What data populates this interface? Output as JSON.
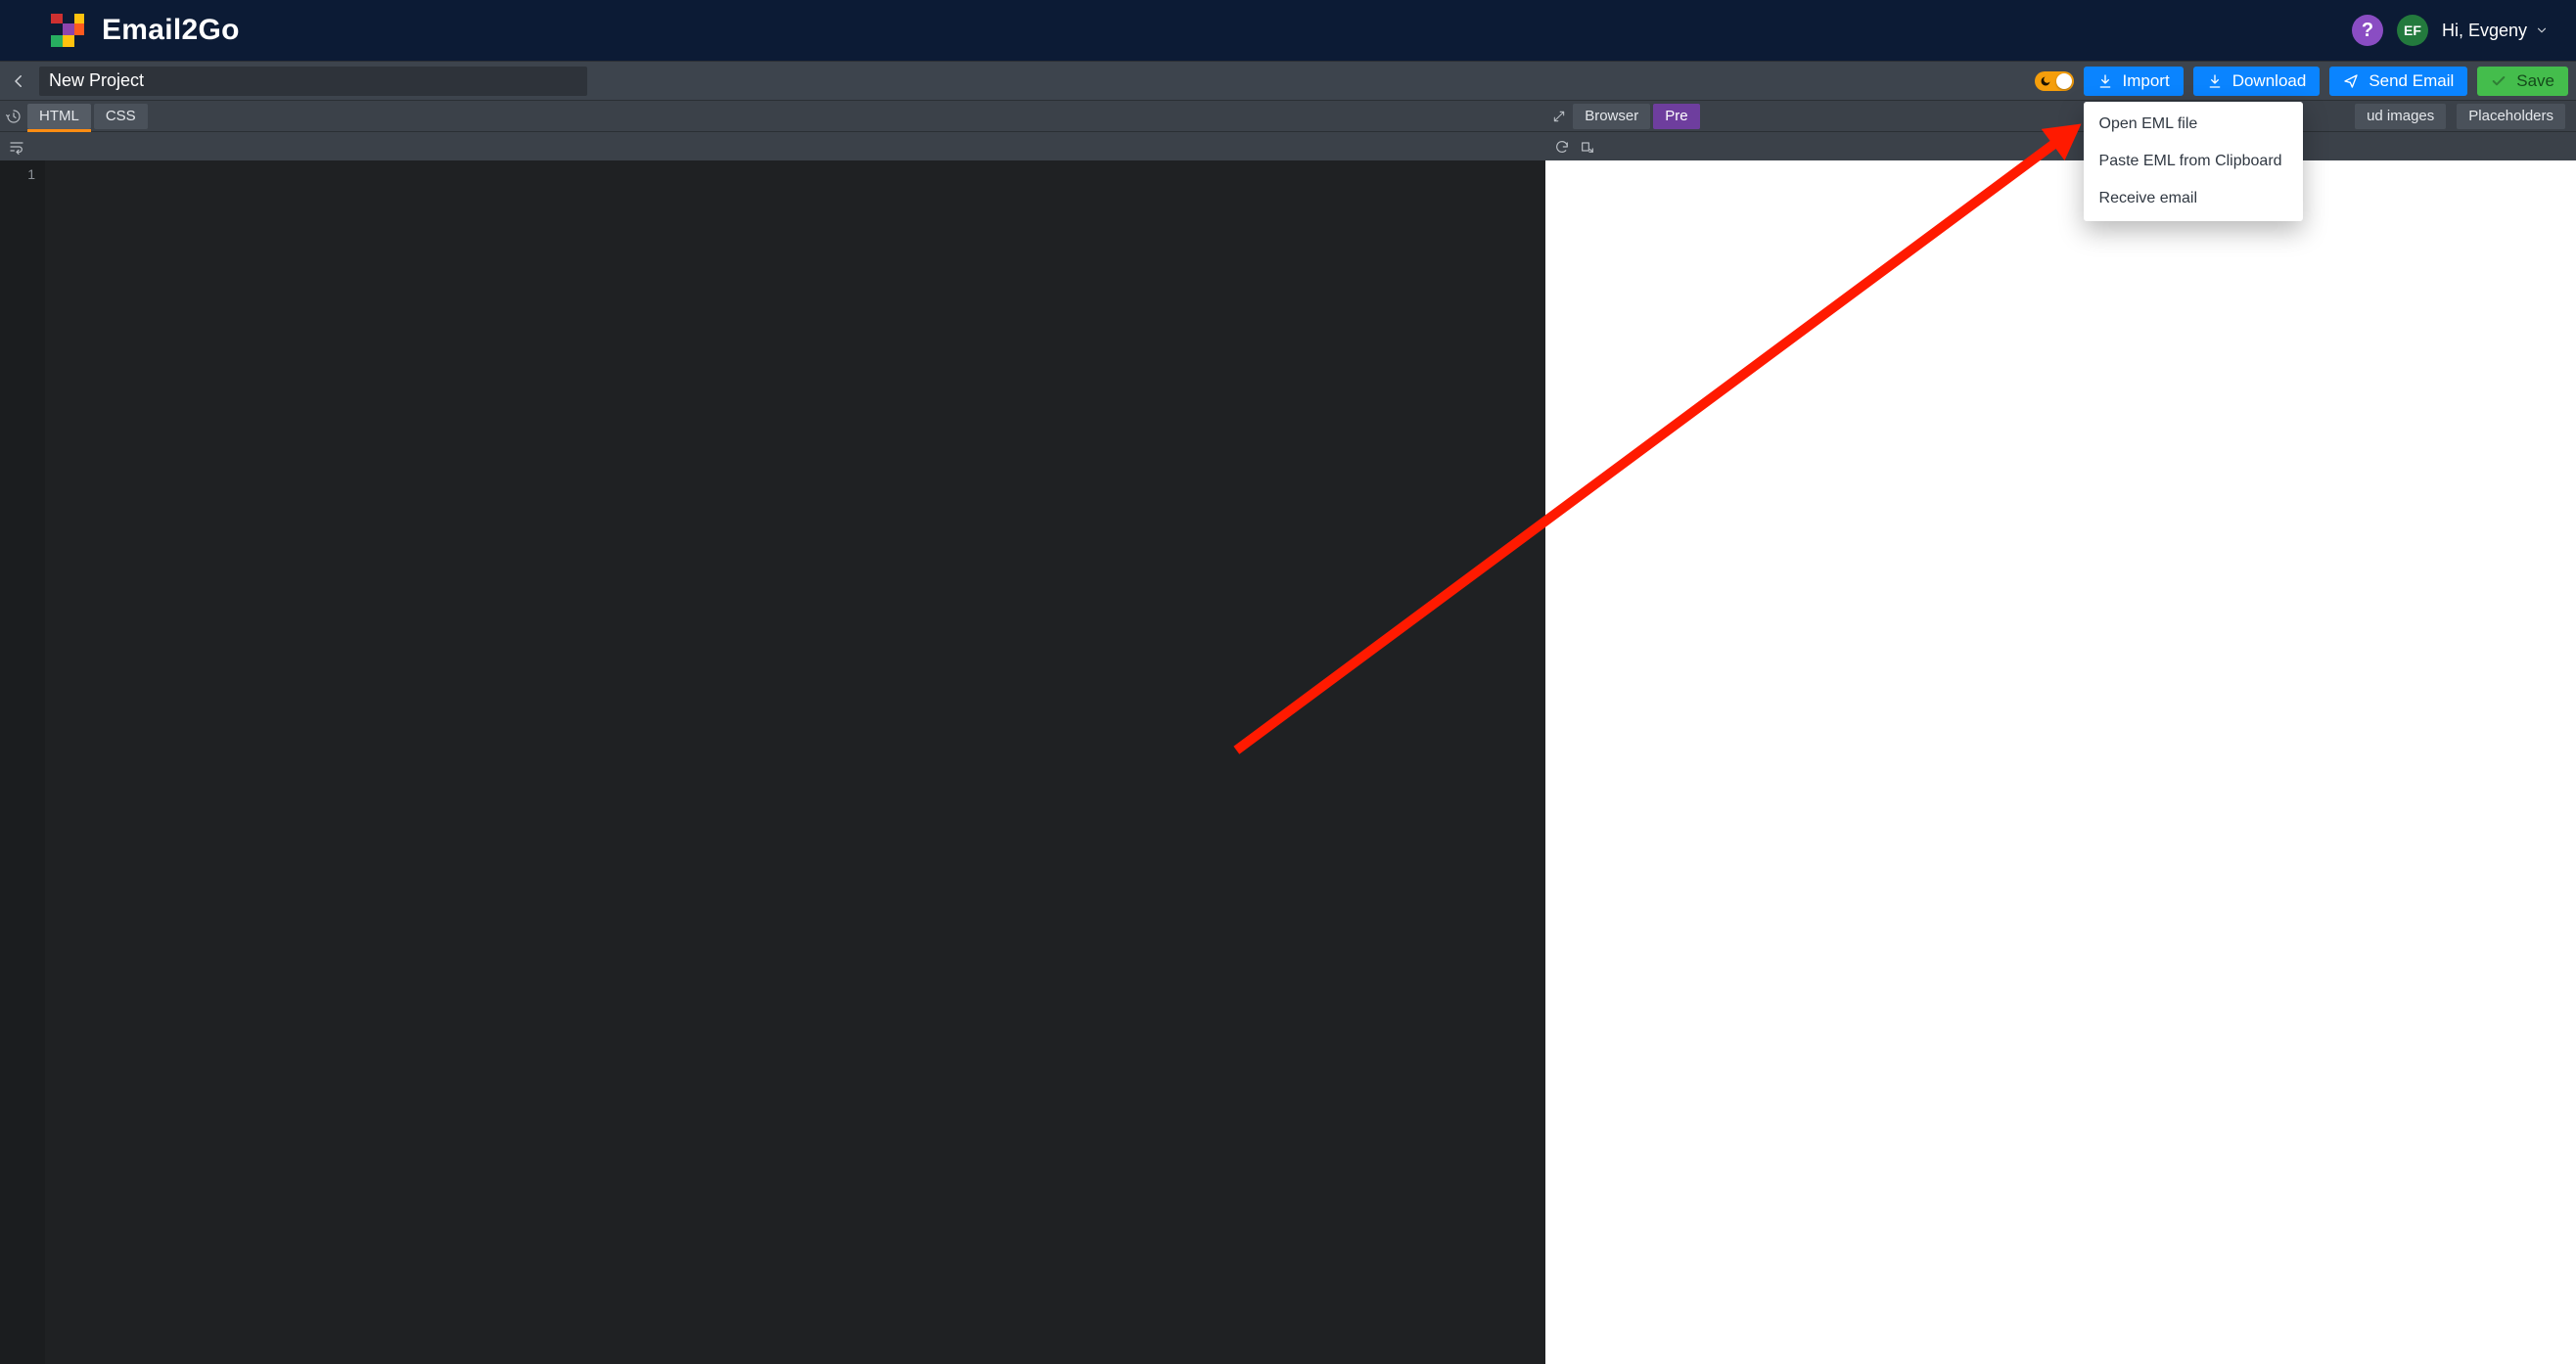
{
  "brand": {
    "name": "Email2Go"
  },
  "header": {
    "greeting": "Hi, Evgeny",
    "avatar_initials": "EF",
    "help_symbol": "?"
  },
  "toolbar": {
    "project_name": "New Project",
    "buttons": {
      "import": "Import",
      "download": "Download",
      "send_email": "Send Email",
      "save": "Save"
    }
  },
  "left_tabs": {
    "html": "HTML",
    "css": "CSS"
  },
  "right_tabs": {
    "browser": "Browser",
    "pre": "Pre",
    "ud_images_suffix": "ud images",
    "placeholders": "Placeholders"
  },
  "editor": {
    "gutter_line": "1"
  },
  "import_menu": {
    "open_eml": "Open EML file",
    "paste_eml": "Paste EML from Clipboard",
    "receive_email": "Receive email"
  },
  "colors": {
    "blue": "#0a84ff",
    "green": "#44bd4c",
    "orange": "#f59e0b",
    "purple": "#8a4dc3",
    "avatar": "#237a3d",
    "tab_active_underline": "#ff8c12",
    "tab_pre": "#6e3e9e",
    "arrow": "#ff1a00"
  }
}
